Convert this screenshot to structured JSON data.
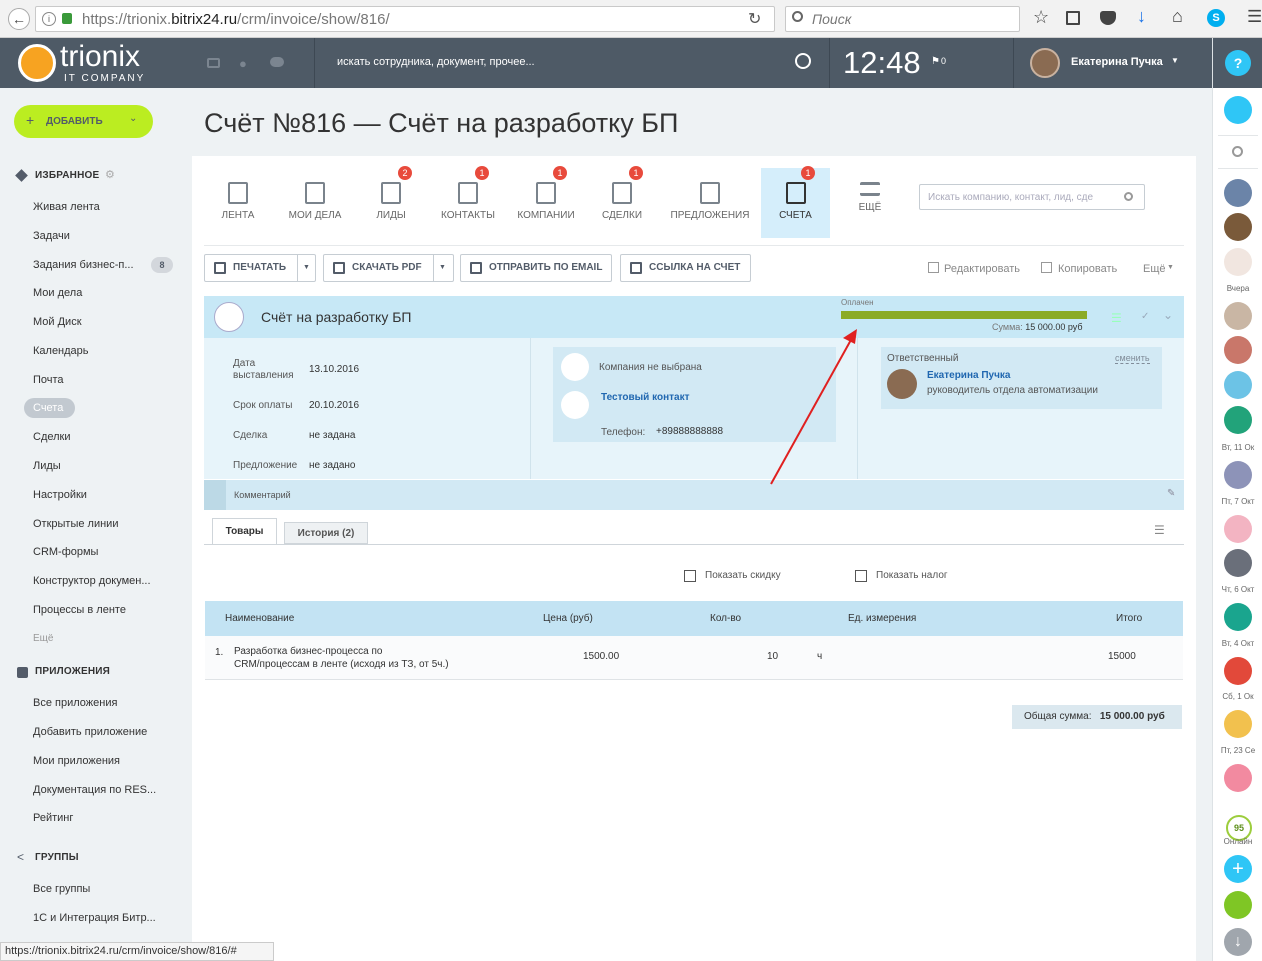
{
  "browser": {
    "url_prefix": "https://trionix.",
    "url_domain": "bitrix24.ru",
    "url_path": "/crm/invoice/show/816/",
    "search_placeholder": "Поиск",
    "status_url": "https://trionix.bitrix24.ru/crm/invoice/show/816/#"
  },
  "topbar": {
    "logo_name": "trionix",
    "logo_sub": "IT COMPANY",
    "search_placeholder": "искать сотрудника, документ, прочее...",
    "time": "12:48",
    "flag_count": "0",
    "user_name": "Екатерина Пучка",
    "help": "?"
  },
  "leftmenu": {
    "add_button": "ДОБАВИТЬ",
    "favorites": "ИЗБРАННОЕ",
    "items": [
      {
        "label": "Живая лента"
      },
      {
        "label": "Задачи"
      },
      {
        "label": "Задания бизнес-п...",
        "count": "8"
      },
      {
        "label": "Мои дела"
      },
      {
        "label": "Мой Диск"
      },
      {
        "label": "Календарь"
      },
      {
        "label": "Почта"
      },
      {
        "label": "Счета"
      },
      {
        "label": "Сделки"
      },
      {
        "label": "Лиды"
      },
      {
        "label": "Настройки"
      },
      {
        "label": "Открытые линии"
      },
      {
        "label": "CRM-формы"
      },
      {
        "label": "Конструктор докумен..."
      },
      {
        "label": "Процессы в ленте"
      },
      {
        "label": "Ещё"
      }
    ],
    "apps_title": "ПРИЛОЖЕНИЯ",
    "apps": [
      {
        "label": "Все приложения"
      },
      {
        "label": "Добавить приложение"
      },
      {
        "label": "Мои приложения"
      },
      {
        "label": "Документация по RES..."
      },
      {
        "label": "Рейтинг"
      }
    ],
    "groups_title": "ГРУППЫ",
    "groups": [
      {
        "label": "Все группы"
      },
      {
        "label": "1С и Интеграция Битр..."
      }
    ]
  },
  "page": {
    "title": "Счёт №816 — Счёт на разработку БП"
  },
  "crm_tabs": [
    {
      "label": "ЛЕНТА",
      "badge": ""
    },
    {
      "label": "МОИ ДЕЛА",
      "badge": ""
    },
    {
      "label": "ЛИДЫ",
      "badge": "2"
    },
    {
      "label": "КОНТАКТЫ",
      "badge": "1"
    },
    {
      "label": "КОМПАНИИ",
      "badge": "1"
    },
    {
      "label": "СДЕЛКИ",
      "badge": "1"
    },
    {
      "label": "ПРЕДЛОЖЕНИЯ",
      "badge": ""
    },
    {
      "label": "СЧЕТА",
      "badge": "1"
    },
    {
      "label": "ЕЩЁ",
      "badge": ""
    }
  ],
  "crm_search_placeholder": "Искать компанию, контакт, лид, сде",
  "toolbar": {
    "print": "ПЕЧАТАТЬ",
    "download_pdf": "СКАЧАТЬ PDF",
    "send_email": "ОТПРАВИТЬ ПО EMAIL",
    "link": "ССЫЛКА НА СЧЕТ",
    "edit": "Редактировать",
    "copy": "Копировать",
    "more": "Ещё"
  },
  "invoice": {
    "name": "Счёт на разработку БП",
    "status": "Оплачен",
    "status_progress": 1.0,
    "sum_label": "Сумма:",
    "sum_value": "15 000.00 руб",
    "date_label_1": "Дата",
    "date_label_2": "выставления",
    "date_value": "13.10.2016",
    "due_label": "Срок оплаты",
    "due_value": "20.10.2016",
    "deal_label": "Сделка",
    "deal_value": "не задана",
    "offer_label": "Предложение",
    "offer_value": "не задано",
    "company": "Компания не выбрана",
    "contact": "Тестовый контакт",
    "phone_label": "Телефон:",
    "phone_value": "+89888888888",
    "responsible_label": "Ответственный",
    "change": "сменить",
    "responsible_name": "Екатерина Пучка",
    "responsible_post": "руководитель отдела автоматизации",
    "comment_label": "Комментарий"
  },
  "subtabs": {
    "goods": "Товары",
    "history": "История (2)"
  },
  "options": {
    "show_discount": "Показать скидку",
    "show_tax": "Показать налог"
  },
  "table": {
    "headers": [
      "Наименование",
      "Цена (руб)",
      "Кол-во",
      "Ед. измерения",
      "Итого"
    ],
    "rows": [
      {
        "num": "1.",
        "name_line1": "Разработка бизнес-процесса по",
        "name_line2": "CRM/процессам в ленте (исходя из ТЗ, от 5ч.)",
        "price": "1500.00",
        "qty": "10",
        "unit": "ч",
        "total": "15000"
      }
    ],
    "total_label": "Общая сумма:",
    "total_value": "15 000.00 руб"
  },
  "rightbar": {
    "labels": [
      "Вчера",
      "Вт, 11 Ок",
      "Пт, 7 Окт",
      "Чт, 6 Окт",
      "Вт, 4 Окт",
      "Сб, 1 Ок",
      "Пт, 23 Се"
    ],
    "online_count": "95",
    "online_label": "Онлайн"
  },
  "colors": {
    "accent_green": "#bbed21",
    "topbar": "#4e5a66",
    "blue": "#2fc6f6",
    "paid_green": "#8bab26",
    "link": "#2067b0"
  }
}
